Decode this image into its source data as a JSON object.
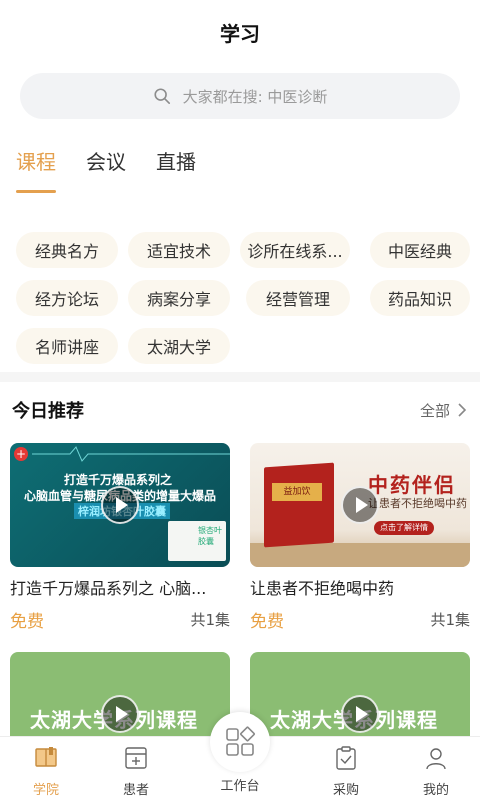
{
  "header": {
    "title": "学习"
  },
  "search": {
    "placeholder": "大家都在搜: 中医诊断"
  },
  "tabs": [
    {
      "label": "课程",
      "active": true
    },
    {
      "label": "会议",
      "active": false
    },
    {
      "label": "直播",
      "active": false
    }
  ],
  "chips": [
    "经典名方",
    "适宜技术",
    "诊所在线系...",
    "中医经典",
    "经方论坛",
    "病案分享",
    "经营管理",
    "药品知识",
    "名师讲座",
    "太湖大学"
  ],
  "recommend": {
    "title": "今日推荐",
    "more_label": "全部",
    "cards": [
      {
        "title": "打造千万爆品系列之 心脑...",
        "price": "免费",
        "episodes": "共1集",
        "thumb_text": {
          "line1": "打造千万爆品系列之",
          "line2": "心脑血管与糖尿病品类的增量大爆品",
          "line3": "梓润坊银杏叶胶囊",
          "product": "银杏叶胶囊"
        }
      },
      {
        "title": "让患者不拒绝喝中药",
        "price": "免费",
        "episodes": "共1集",
        "thumb_text": {
          "heading": "中药伴侣",
          "sub": "让患者不拒绝喝中药",
          "cta": "点击了解详情",
          "brand": "益加饮"
        }
      },
      {
        "thumb_text": {
          "heading": "太湖大学系列课程"
        }
      },
      {
        "thumb_text": {
          "heading": "太湖大学系列课程"
        }
      }
    ]
  },
  "bottom_nav": [
    {
      "label": "学院",
      "icon": "book-icon",
      "active": true
    },
    {
      "label": "患者",
      "icon": "patient-icon",
      "active": false
    },
    {
      "label": "工作台",
      "icon": "workbench-icon",
      "active": false
    },
    {
      "label": "采购",
      "icon": "purchase-icon",
      "active": false
    },
    {
      "label": "我的",
      "icon": "profile-icon",
      "active": false
    }
  ],
  "colors": {
    "accent": "#e4a04e",
    "price": "#e8a043",
    "chip_bg": "#fbf7ee"
  }
}
